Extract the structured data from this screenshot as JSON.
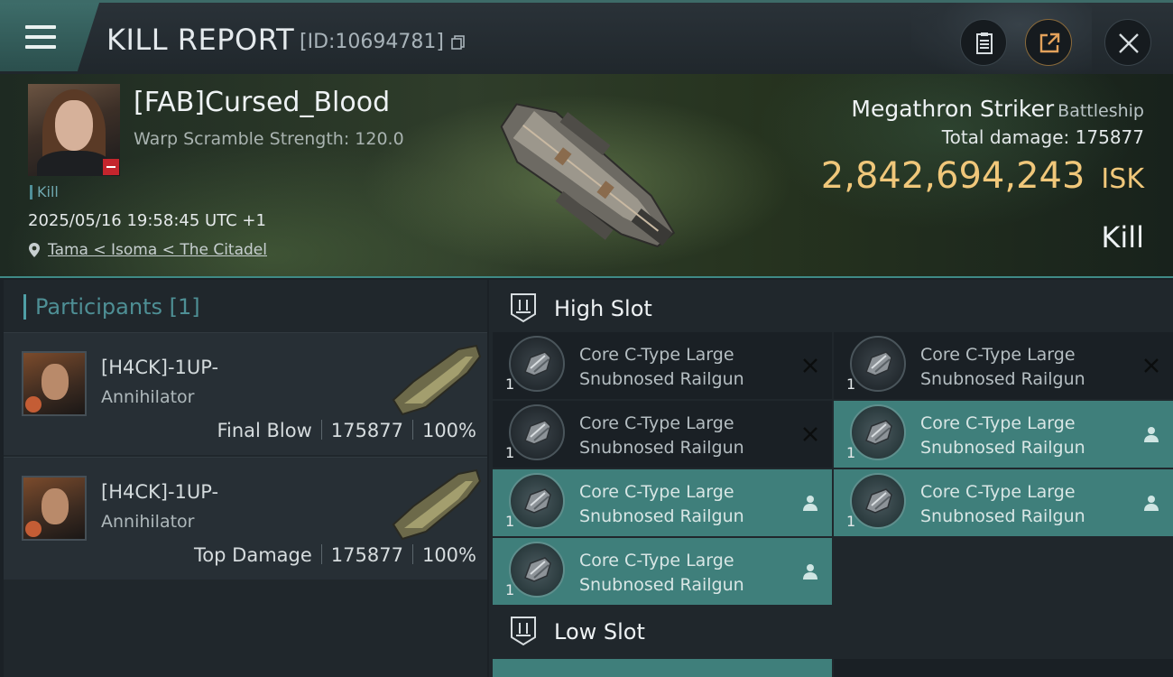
{
  "header": {
    "title": "KILL REPORT",
    "id_text": "[ID:10694781]"
  },
  "victim": {
    "name": "[FAB]Cursed_Blood",
    "warp_text": "Warp Scramble Strength: 120.0",
    "type_tag": "Kill",
    "datetime": "2025/05/16 19:58:45 UTC +1",
    "location": "Tama < Isoma < The Citadel"
  },
  "ship": {
    "name": "Megathron Striker",
    "class": "Battleship",
    "total_damage_label": "Total damage:",
    "total_damage": "175877",
    "isk_value": "2,842,694,243",
    "isk_unit": "ISK",
    "result": "Kill"
  },
  "participants": {
    "header": "Participants [1]",
    "rows": [
      {
        "name": "[H4CK]-1UP-",
        "ship": "Annihilator",
        "role": "Final Blow",
        "damage": "175877",
        "percent": "100%"
      },
      {
        "name": "[H4CK]-1UP-",
        "ship": "Annihilator",
        "role": "Top Damage",
        "damage": "175877",
        "percent": "100%"
      }
    ]
  },
  "fittings": {
    "high_slot_label": "High Slot",
    "low_slot_label": "Low Slot",
    "modules": [
      {
        "line1": "Core C-Type Large",
        "line2": "Snubnosed Railgun",
        "qty": "1",
        "status": "destroyed"
      },
      {
        "line1": "Core C-Type Large",
        "line2": "Snubnosed Railgun",
        "qty": "1",
        "status": "destroyed"
      },
      {
        "line1": "Core C-Type Large",
        "line2": "Snubnosed Railgun",
        "qty": "1",
        "status": "destroyed"
      },
      {
        "line1": "Core C-Type Large",
        "line2": "Snubnosed Railgun",
        "qty": "1",
        "status": "dropped"
      },
      {
        "line1": "Core C-Type Large",
        "line2": "Snubnosed Railgun",
        "qty": "1",
        "status": "dropped"
      },
      {
        "line1": "Core C-Type Large",
        "line2": "Snubnosed Railgun",
        "qty": "1",
        "status": "dropped"
      },
      {
        "line1": "Core C-Type Large",
        "line2": "Snubnosed Railgun",
        "qty": "1",
        "status": "dropped"
      }
    ]
  },
  "icons": {
    "menu": "hamburger-icon",
    "copy": "copy-icon",
    "clipboard": "clipboard-icon",
    "share": "share-icon",
    "close": "close-icon",
    "location": "location-pin-icon",
    "destroyed": "x-icon",
    "dropped": "person-icon"
  },
  "colors": {
    "accent_teal": "#3f7f7b",
    "isk_gold": "#f0c77a",
    "victim_badge_red": "#c4252d"
  }
}
